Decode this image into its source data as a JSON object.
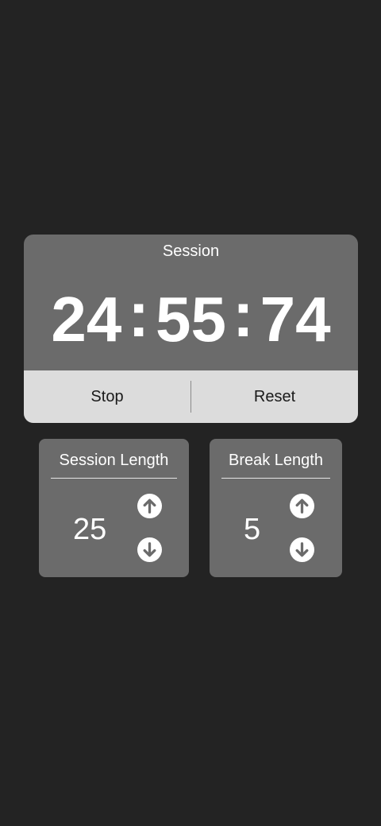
{
  "timer": {
    "label": "Session",
    "minutes": "24",
    "seconds": "55",
    "hundredths": "74",
    "separator": ":"
  },
  "controls": {
    "stop_label": "Stop",
    "reset_label": "Reset"
  },
  "session_length": {
    "title": "Session Length",
    "value": "25"
  },
  "break_length": {
    "title": "Break Length",
    "value": "5"
  },
  "icons": {
    "increment": "arrow-up-circle-icon",
    "decrement": "arrow-down-circle-icon"
  },
  "colors": {
    "background": "#232323",
    "card": "#6b6b6b",
    "controls_bar": "#dcdcdc",
    "text_light": "#ffffff",
    "text_dark": "#1a1a1a"
  }
}
